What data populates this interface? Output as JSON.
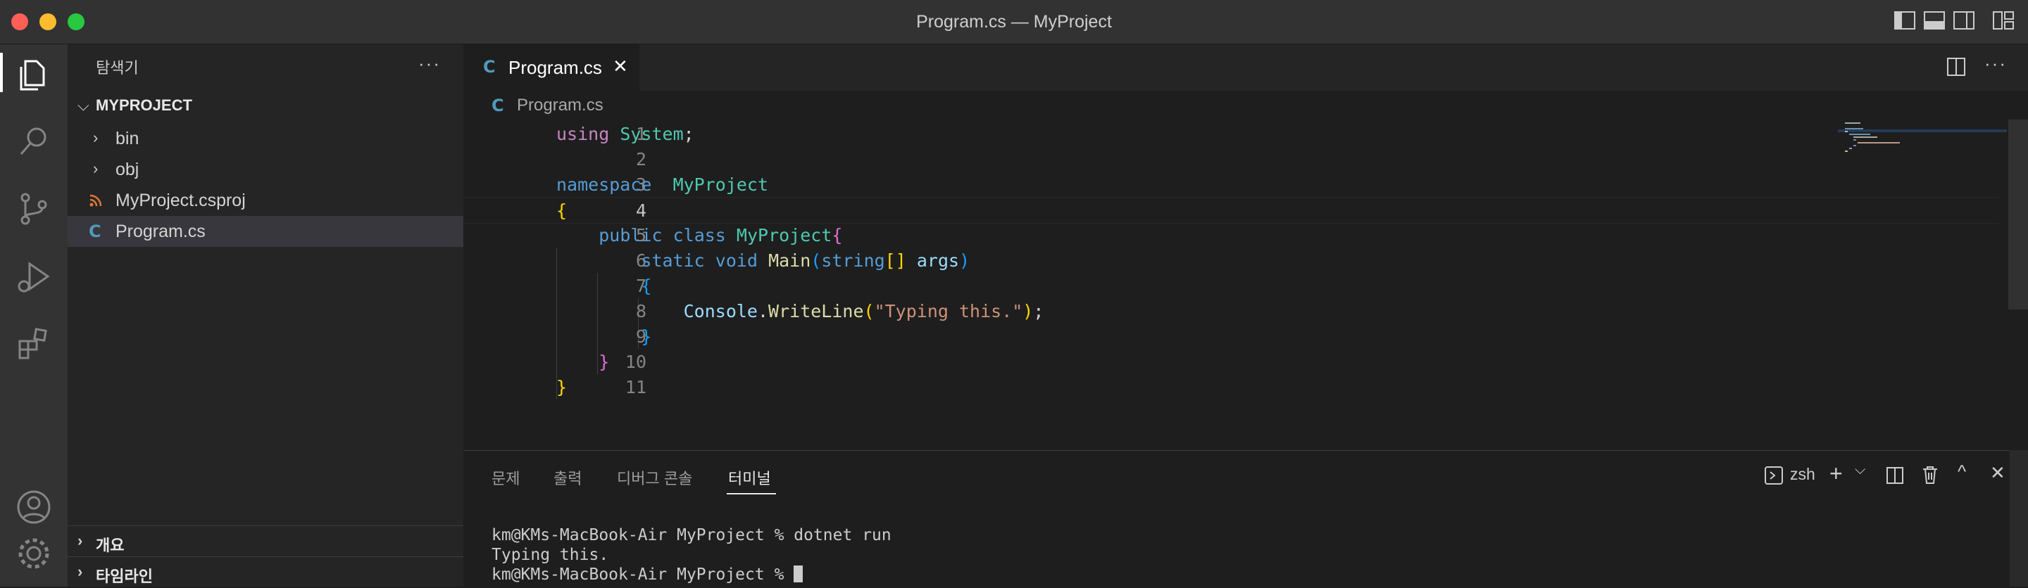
{
  "window": {
    "title": "Program.cs — MyProject"
  },
  "sidebar": {
    "title": "탐색기",
    "more": "···",
    "section": "MYPROJECT",
    "items": [
      {
        "label": "bin",
        "kind": "folder"
      },
      {
        "label": "obj",
        "kind": "folder"
      },
      {
        "label": "MyProject.csproj",
        "kind": "csproj-file",
        "icon": "rss-icon"
      },
      {
        "label": "Program.cs",
        "kind": "cs-file",
        "icon": "csharp-icon",
        "selected": true
      }
    ],
    "bottom_sections": [
      "개요",
      "타임라인"
    ]
  },
  "editor": {
    "tab": {
      "label": "Program.cs",
      "close": "✕"
    },
    "breadcrumb": "Program.cs",
    "line_numbers": [
      "1",
      "2",
      "3",
      "4",
      "5",
      "6",
      "7",
      "8",
      "9",
      "10",
      "11"
    ],
    "current_line": 4,
    "tokens": {
      "using": "using",
      "system": "System",
      "semi": ";",
      "namespace": "namespace",
      "ns_name": "MyProject",
      "brace_open": "{",
      "brace_close": "}",
      "public": "public",
      "class": "class",
      "class_name": "MyProject",
      "static": "static",
      "void": "void",
      "main": "Main",
      "paren_open": "(",
      "paren_close": ")",
      "string": "string",
      "brackets": "[]",
      "args": "args",
      "console": "Console",
      "dot": ".",
      "writeline": "WriteLine",
      "literal": "\"Typing this.\""
    }
  },
  "panel": {
    "tabs": [
      "문제",
      "출력",
      "디버그 콘솔",
      "터미널"
    ],
    "active_tab": "터미널",
    "shell": "zsh",
    "terminal_lines": [
      "km@KMs-MacBook-Air MyProject % dotnet run",
      "Typing this.",
      "km@KMs-MacBook-Air MyProject % "
    ]
  },
  "colors": {
    "accent_cs": "#519aba",
    "csproj": "#e37933",
    "traffic_close": "#ff5f57",
    "traffic_min": "#febc2e",
    "traffic_max": "#28c840"
  }
}
